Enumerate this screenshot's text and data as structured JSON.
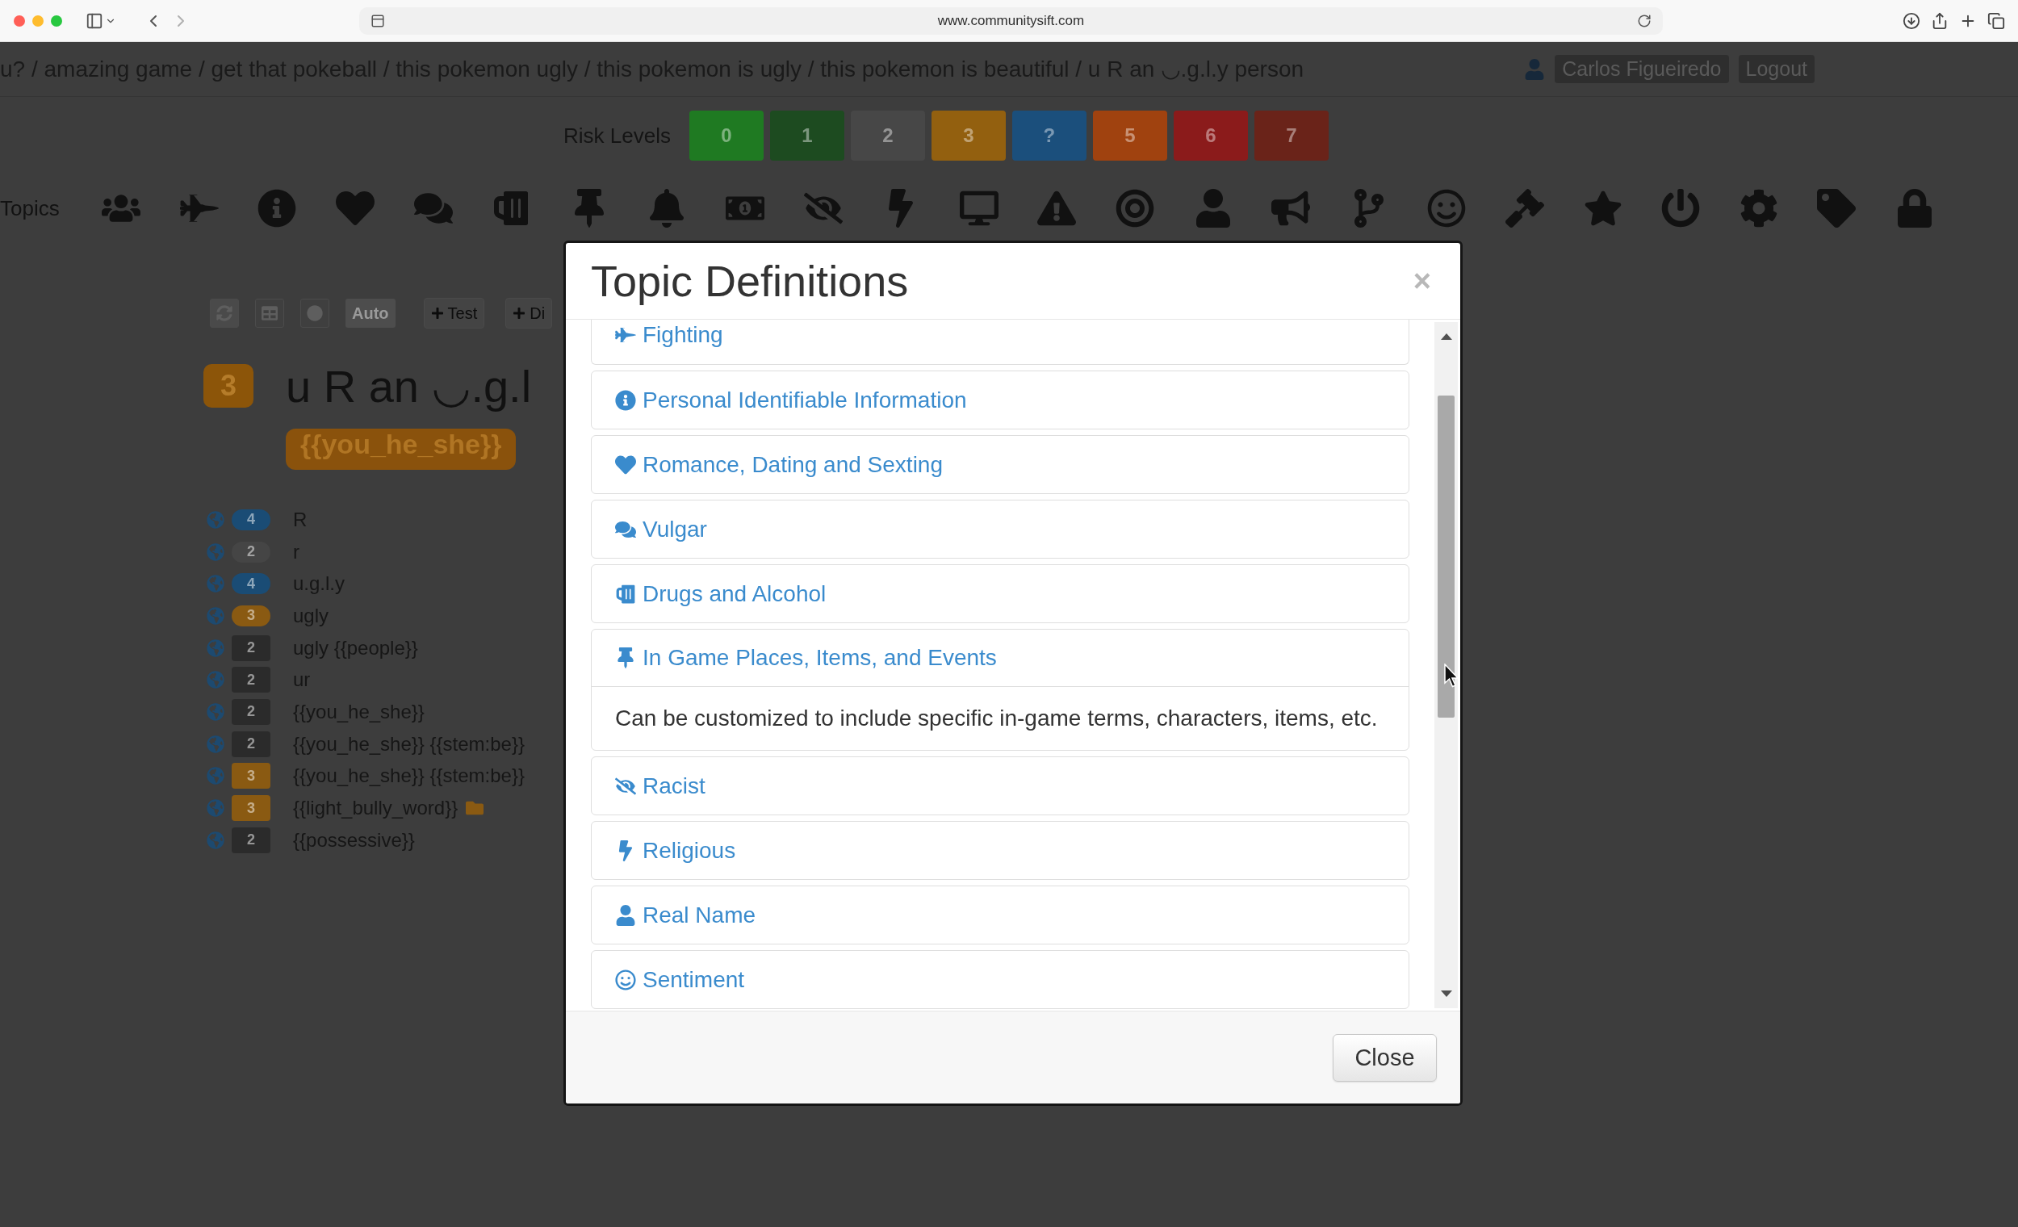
{
  "browser": {
    "url": "www.communitysift.com"
  },
  "header": {
    "breadcrumb": "u? / amazing game / get that pokeball / this pokemon ugly / this pokemon is ugly / this pokemon is beautiful / u R an ◡.g.l.y person",
    "user": "Carlos Figueiredo",
    "logout": "Logout"
  },
  "risk_levels": {
    "label": "Risk Levels",
    "levels": [
      {
        "label": "0",
        "color": "#1f7a22"
      },
      {
        "label": "1",
        "color": "#1d4b20"
      },
      {
        "label": "2",
        "color": "#474747"
      },
      {
        "label": "3",
        "color": "#93600f"
      },
      {
        "label": "?",
        "color": "#1b4f7c"
      },
      {
        "label": "5",
        "color": "#a0420f"
      },
      {
        "label": "6",
        "color": "#8b1b1b"
      },
      {
        "label": "7",
        "color": "#6a2319"
      }
    ]
  },
  "topics": {
    "label": "Topics"
  },
  "toolbar": {
    "toggle": "Auto",
    "add_buttons": [
      "Test",
      "Di"
    ]
  },
  "phrase": {
    "risk": "3",
    "color": "#8c5509",
    "text": "u R an ◡.g.l",
    "tag": "{{you_he_she}}"
  },
  "rules": [
    {
      "kind": "pill",
      "risk": "4",
      "color": "#1a4c75",
      "text": "R",
      "marked": false
    },
    {
      "kind": "pill",
      "risk": "2",
      "color": "#454545",
      "text": "r",
      "marked": false
    },
    {
      "kind": "pill",
      "risk": "4",
      "color": "#1a4c75",
      "text": "u.g.l.y",
      "marked": false
    },
    {
      "kind": "pill",
      "risk": "3",
      "color": "#8a5a12",
      "text": "ugly",
      "marked": false
    },
    {
      "kind": "label",
      "risk": "2",
      "color": "#2b2b2b",
      "text": "ugly {{people}}",
      "marked": false
    },
    {
      "kind": "label",
      "risk": "2",
      "color": "#2b2b2b",
      "text": "ur",
      "marked": false
    },
    {
      "kind": "label",
      "risk": "2",
      "color": "#2b2b2b",
      "text": "{{you_he_she}}",
      "marked": false
    },
    {
      "kind": "label",
      "risk": "2",
      "color": "#2b2b2b",
      "text": "{{you_he_she}} {{stem:be}}",
      "marked": false
    },
    {
      "kind": "label",
      "risk": "3",
      "color": "#8a5a12",
      "text": "{{you_he_she}} {{stem:be}}",
      "marked": false
    },
    {
      "kind": "label",
      "risk": "3",
      "color": "#8a5a12",
      "text": "{{light_bully_word}}",
      "marked": true
    },
    {
      "kind": "label",
      "risk": "2",
      "color": "#2b2b2b",
      "text": "{{possessive}}",
      "marked": false
    }
  ],
  "modal": {
    "title": "Topic Definitions",
    "close_symbol": "×",
    "topics": [
      {
        "title": "Fighting",
        "expanded": false
      },
      {
        "title": "Personal Identifiable Information",
        "expanded": false
      },
      {
        "title": "Romance, Dating and Sexting",
        "expanded": false
      },
      {
        "title": "Vulgar",
        "expanded": false
      },
      {
        "title": "Drugs and Alcohol",
        "expanded": false
      },
      {
        "title": "In Game Places, Items, and Events",
        "expanded": true,
        "description": "Can be customized to include specific in-game terms, characters, items, etc."
      },
      {
        "title": "Racist",
        "expanded": false
      },
      {
        "title": "Religious",
        "expanded": false
      },
      {
        "title": "Real Name",
        "expanded": false
      },
      {
        "title": "Sentiment",
        "expanded": false
      }
    ],
    "close_button": "Close"
  }
}
